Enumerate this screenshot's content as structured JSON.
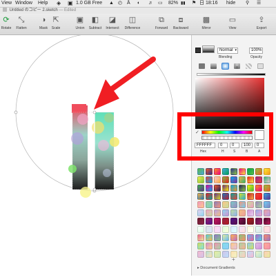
{
  "menubar": {
    "items": [
      "View",
      "Window",
      "Help"
    ],
    "free_memory": "1.0 GB Free",
    "battery": "82%",
    "clock": "日 18:16",
    "user": "hide"
  },
  "titlebar": {
    "document_title": "Untitled のコピー 2.sketch",
    "separator": "—",
    "status": "Edited"
  },
  "toolbar": {
    "rotate": "Rotate",
    "flatten": "Flatten",
    "mask": "Mask",
    "scale": "Scale",
    "union": "Union",
    "subtract": "Subtract",
    "intersect": "Intersect",
    "difference": "Difference",
    "forward": "Forward",
    "backward": "Backward",
    "mirror": "Mirror",
    "view": "View",
    "export": "Export"
  },
  "inspector": {
    "blend_mode": "Normal",
    "opacity": "100%",
    "blending_label": "Blending",
    "opacity_label": "Opacity",
    "hex_value": "FFFFFF",
    "h_value": "0",
    "s_value": "0",
    "b_value": "100",
    "a_value": "0",
    "hex_label": "Hex",
    "h_label": "H",
    "s_label": "S",
    "b_label": "B",
    "a_label": "A",
    "document_gradients": "Document Gradients",
    "add_symbol": "+"
  },
  "colors": {
    "accent_red": "#ff0000",
    "arrow_red": "#f01e23",
    "picker_hue": "#e53030"
  }
}
